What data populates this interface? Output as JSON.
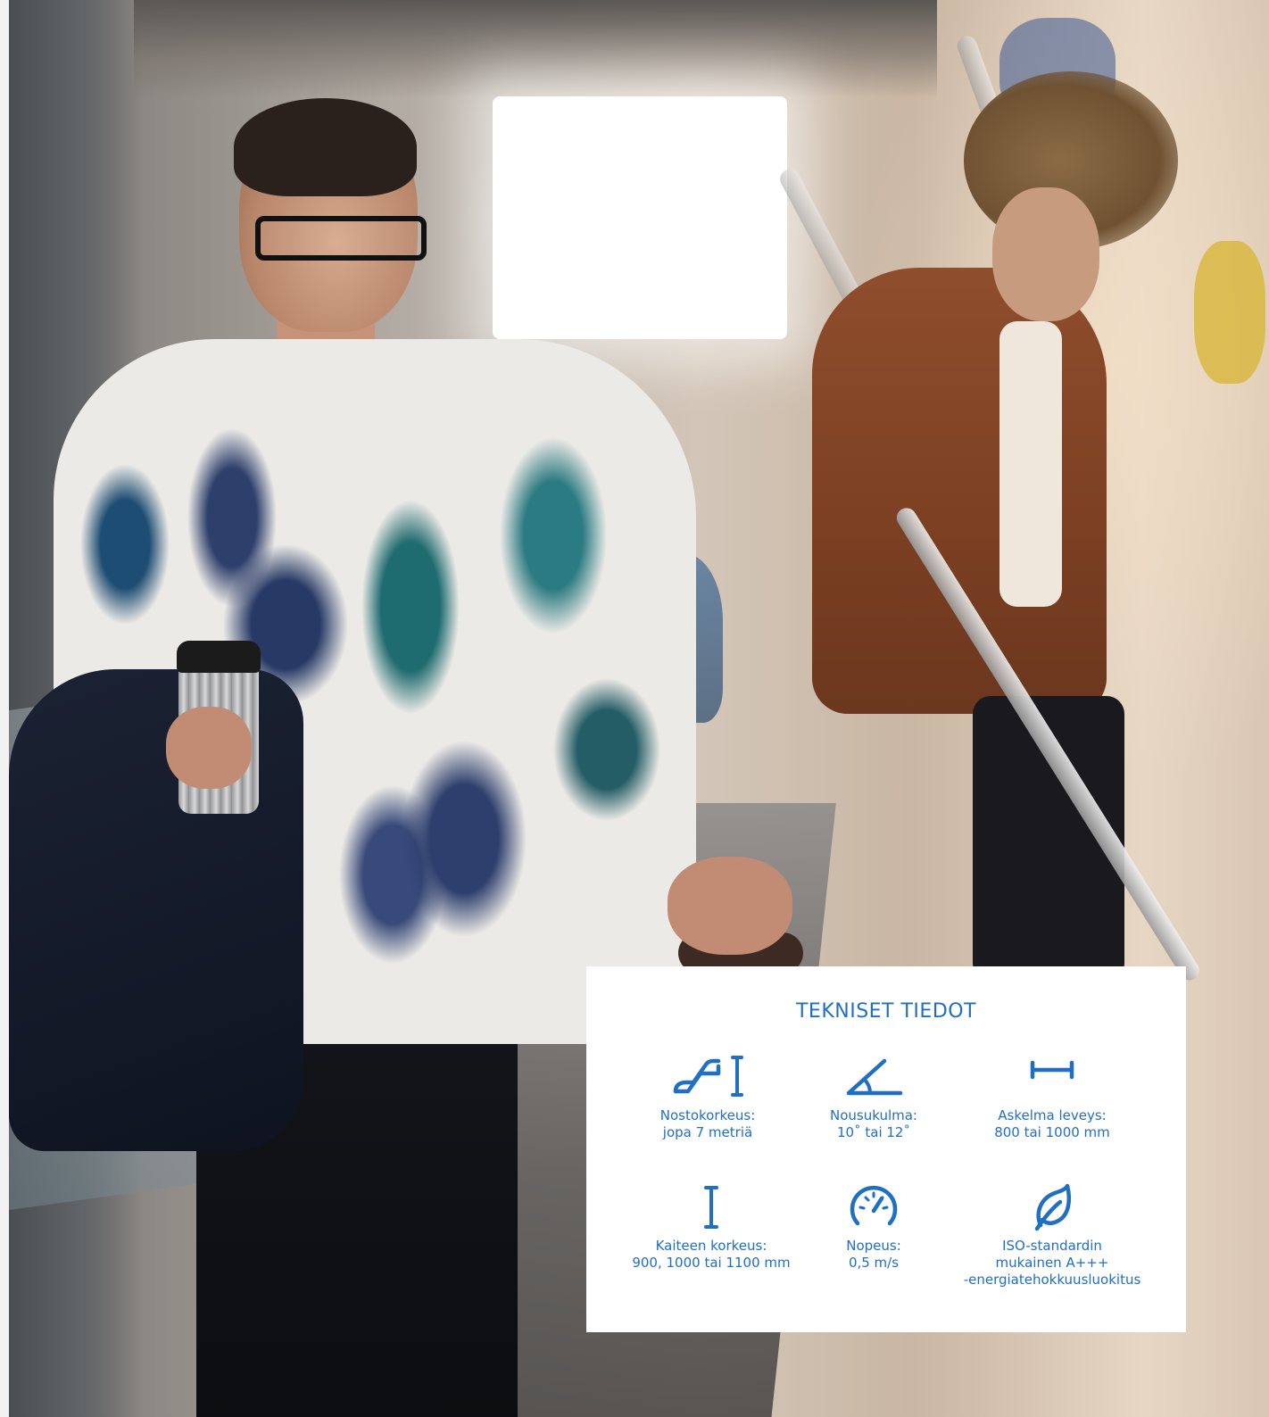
{
  "card": {
    "title": "TEKNISET TIEDOT",
    "accent_color": "#1f6fc4",
    "specs": [
      {
        "icon": "escalator-height-icon",
        "label": "Nostokorkeus:",
        "value": "jopa 7 metriä"
      },
      {
        "icon": "angle-icon",
        "label": "Nousukulma:",
        "value": "10˚ tai 12˚"
      },
      {
        "icon": "width-icon",
        "label": "Askelma leveys:",
        "value": "800 tai 1000 mm"
      },
      {
        "icon": "handrail-height-icon",
        "label": "Kaiteen korkeus:",
        "value": "900, 1000 tai 1100 mm"
      },
      {
        "icon": "speedometer-icon",
        "label": "Nopeus:",
        "value": "0,5 m/s"
      },
      {
        "icon": "leaf-icon",
        "label": "ISO-standardin",
        "value": "mukainen A+++",
        "value2": "-energiatehokkuusluokitus"
      }
    ]
  }
}
